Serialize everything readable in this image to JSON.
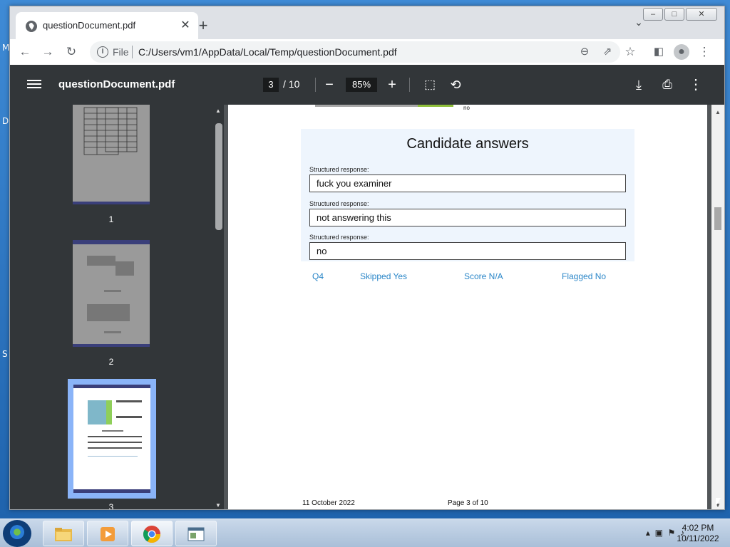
{
  "desktop": {
    "letters": [
      "M",
      "D",
      "S"
    ]
  },
  "window": {
    "minimize": "–",
    "maximize": "□",
    "close": "✕"
  },
  "tab": {
    "title": "questionDocument.pdf",
    "close": "✕",
    "new": "+"
  },
  "toolbar": {
    "scheme": "File",
    "url": "C:/Users/vm1/AppData/Local/Temp/questionDocument.pdf"
  },
  "pdf": {
    "title": "questionDocument.pdf",
    "current_page": "3",
    "total_pages": "/ 10",
    "zoom": "85%"
  },
  "thumbnails": [
    {
      "label": "1"
    },
    {
      "label": "2"
    },
    {
      "label": "3",
      "selected": true
    }
  ],
  "page": {
    "top_snippet": "no",
    "answers_title": "Candidate answers",
    "responses": [
      {
        "label": "Structured response:",
        "value": "fuck you examiner"
      },
      {
        "label": "Structured response:",
        "value": "not answering this"
      },
      {
        "label": "Structured response:",
        "value": "no"
      }
    ],
    "meta": {
      "question": "Q4",
      "skipped": "Skipped Yes",
      "score": "Score N/A",
      "flagged": "Flagged No"
    },
    "footer": {
      "date": "11 October 2022",
      "page": "Page 3 of 10"
    }
  },
  "taskbar": {
    "time": "4:02 PM",
    "date": "10/11/2022"
  },
  "colors": {
    "link": "#2a86c8",
    "pdf_toolbar": "#323639",
    "answer_bg": "#eef5fd"
  }
}
